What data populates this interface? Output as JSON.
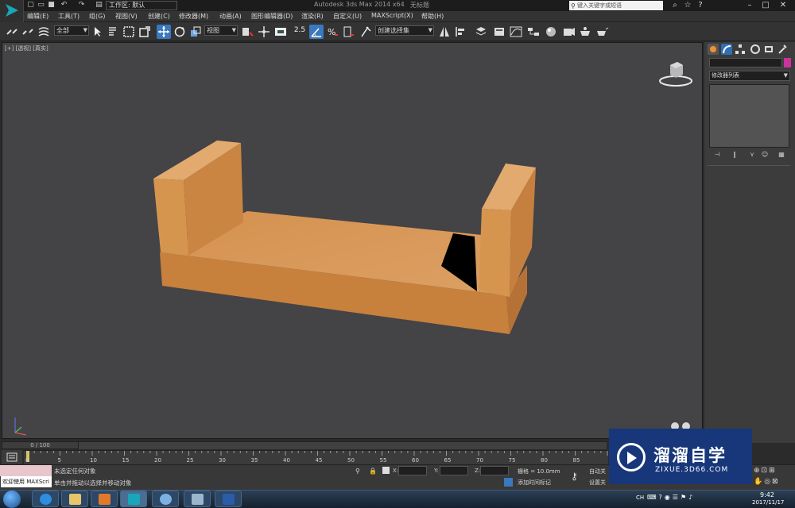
{
  "titlebar": {
    "workspace": "工作区: 默认",
    "app_title": "Autodesk 3ds Max  2014 x64",
    "doc_title": "无标题",
    "search_placeholder": "键入关键字或短语",
    "quick_access": [
      "new-icon",
      "open-icon",
      "save-icon",
      "undo-icon",
      "redo-icon",
      "project-folder-icon"
    ],
    "window_buttons": [
      "minimize-icon",
      "maximize-icon",
      "close-icon"
    ]
  },
  "menus": [
    "编辑(E)",
    "工具(T)",
    "组(G)",
    "视图(V)",
    "创建(C)",
    "修改器(M)",
    "动画(A)",
    "图形编辑器(D)",
    "渲染(R)",
    "自定义(U)",
    "MAXScript(X)",
    "帮助(H)"
  ],
  "toolbar": {
    "selection_filter": "全部",
    "ref_coord": "视图",
    "named_selection": "创建选择集",
    "snap_value": "2.5",
    "accent": "#3a78c0"
  },
  "viewport": {
    "label": "[+] [透视] [真实]",
    "object_color": "#d4914c",
    "background": "#444346"
  },
  "command_panel": {
    "tabs": [
      "create-icon",
      "modify-icon",
      "hierarchy-icon",
      "motion-icon",
      "display-icon",
      "utilities-icon"
    ],
    "modifier_list": "修改器列表",
    "object_color": "#c9339a"
  },
  "timeline": {
    "slider_label": "0 / 100",
    "ticks": [
      "0",
      "5",
      "10",
      "15",
      "20",
      "25",
      "30",
      "35",
      "40",
      "45",
      "50",
      "55",
      "60",
      "65",
      "70",
      "75",
      "80",
      "85"
    ]
  },
  "status": {
    "welcome": "欢迎使用 MAXScri",
    "line1": "未选定任何对象",
    "line2": "单击并拖动以选择并移动对象",
    "x_label": "X:",
    "y_label": "Y:",
    "z_label": "Z:",
    "grid": "栅格 = 10.0mm",
    "add_time_tag": "添加时间标记",
    "auto_key": "自动关",
    "set_key": "设置关"
  },
  "watermark": {
    "brand": "溜溜自学",
    "url": "ZIXUE.3D66.COM"
  },
  "taskbar": {
    "language": "CH",
    "time": "9:42",
    "date": "2017/11/17",
    "apps": [
      "ie-icon",
      "explorer-icon",
      "media-player-icon",
      "3dsmax-icon",
      "paint-icon",
      "screen-icon",
      "word-icon"
    ]
  }
}
